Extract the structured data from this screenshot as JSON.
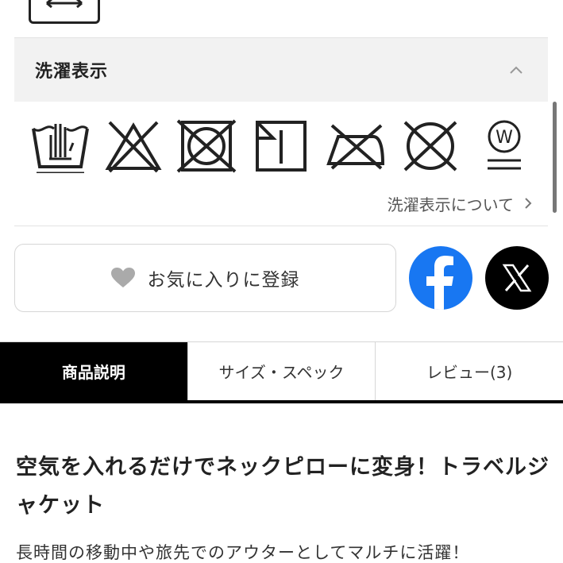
{
  "care": {
    "title": "洗濯表示",
    "link_label": "洗濯表示について",
    "symbols": [
      {
        "icon": "hand-wash-icon"
      },
      {
        "icon": "no-bleach-icon"
      },
      {
        "icon": "no-tumble-dry-icon"
      },
      {
        "icon": "line-dry-shade-icon"
      },
      {
        "icon": "iron-not-allowed-icon"
      },
      {
        "icon": "no-dry-clean-icon"
      },
      {
        "icon": "wet-clean-gentle-icon"
      }
    ],
    "wet_clean_letter": "W"
  },
  "favorite": {
    "label": "お気に入りに登録"
  },
  "share": {
    "facebook_glyph": "f",
    "x_glyph": "𝕏"
  },
  "tabs": [
    {
      "label": "商品説明",
      "active": true
    },
    {
      "label": "サイズ・スペック",
      "active": false
    },
    {
      "label": "レビュー(3)",
      "active": false
    }
  ],
  "product": {
    "title": "空気を入れるだけでネックピローに変身！トラベルジャケット",
    "lead": "長時間の移動中や旅先でのアウターとしてマルチに活躍！"
  },
  "colors": {
    "facebook": "#1877f2",
    "x": "#000000",
    "header_bg": "#f2f2f2",
    "active_tab_bg": "#000000"
  }
}
